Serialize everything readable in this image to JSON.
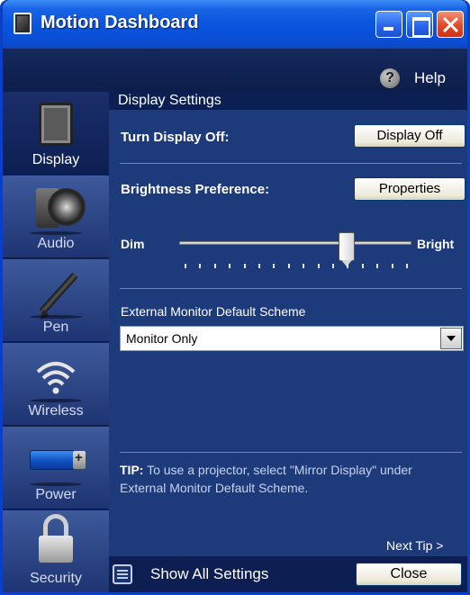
{
  "window": {
    "title": "Motion Dashboard"
  },
  "helpbar": {
    "help_label": "Help",
    "help_icon": "question-mark-icon"
  },
  "sidebar": {
    "items": [
      {
        "label": "Display",
        "icon": "tablet-display-icon",
        "active": true
      },
      {
        "label": "Audio",
        "icon": "speaker-icon",
        "active": false
      },
      {
        "label": "Pen",
        "icon": "pen-icon",
        "active": false
      },
      {
        "label": "Wireless",
        "icon": "wifi-icon",
        "active": false
      },
      {
        "label": "Power",
        "icon": "battery-icon",
        "active": false
      },
      {
        "label": "Security",
        "icon": "lock-icon",
        "active": false
      }
    ]
  },
  "content": {
    "section_title": "Display Settings",
    "turn_display_off_label": "Turn Display Off:",
    "display_off_button": "Display Off",
    "brightness_label": "Brightness Preference:",
    "properties_button": "Properties",
    "slider": {
      "min_label": "Dim",
      "max_label": "Bright",
      "value_fraction": 0.72,
      "tick_count": 16
    },
    "external_monitor_label": "External Monitor Default Scheme",
    "external_monitor_value": "Monitor Only",
    "tip_prefix": "TIP:",
    "tip_text": " To use a projector, select \"Mirror Display\" under External Monitor Default Scheme.",
    "next_tip": "Next Tip >"
  },
  "footer": {
    "show_all_label": "Show All Settings",
    "close_button": "Close"
  },
  "colors": {
    "content_bg": "#1d3a7a",
    "header_bg": "#0c1f52",
    "titlebar": "#0a54df"
  }
}
